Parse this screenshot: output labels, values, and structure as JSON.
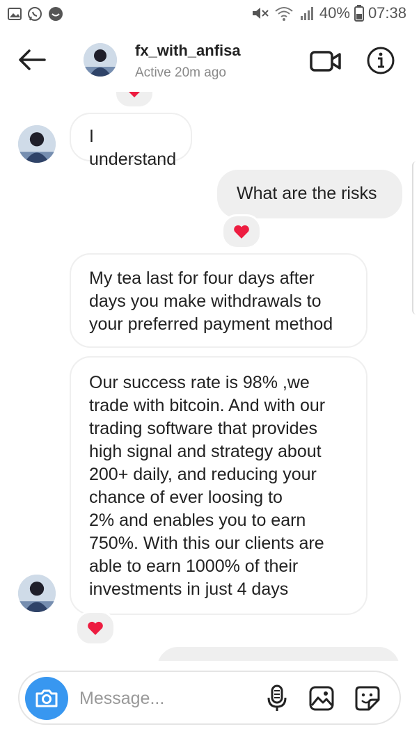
{
  "status_bar": {
    "battery": "40%",
    "time": "07:38",
    "left_icons": [
      "gallery-icon",
      "whatsapp-icon",
      "circle-app-icon"
    ],
    "right_icons": [
      "mute-icon",
      "wifi-icon",
      "signal-icon",
      "battery-icon"
    ]
  },
  "header": {
    "username": "fx_with_anfisa",
    "status": "Active 20m ago",
    "icons": [
      "back-arrow-icon",
      "video-call-icon",
      "info-icon"
    ]
  },
  "messages": [
    {
      "from": "them",
      "text": "I understand"
    },
    {
      "from": "me",
      "text": "What are the risks",
      "reaction": "heart"
    },
    {
      "from": "them",
      "lines": [
        "My tea last for four days after",
        "days you make withdrawals to",
        "your preferred payment method"
      ]
    },
    {
      "from": "them",
      "lines": [
        "Our success rate is 98% ,we",
        "trade with bitcoin. And with our",
        "trading software that provides",
        "high signal and strategy about",
        "200+ daily, and reducing your",
        "chance of ever loosing to",
        "2% and enables you to earn",
        "750%. With this our clients are",
        "able to earn 1000% of their",
        "investments in just 4 days"
      ],
      "reaction": "heart"
    }
  ],
  "composer": {
    "placeholder": "Message...",
    "icons": [
      "camera-icon",
      "microphone-icon",
      "gallery-icon",
      "sticker-icon"
    ]
  },
  "colors": {
    "accent": "#3897f0",
    "heart": "#ed1c40",
    "bubble_me": "#efefef"
  }
}
